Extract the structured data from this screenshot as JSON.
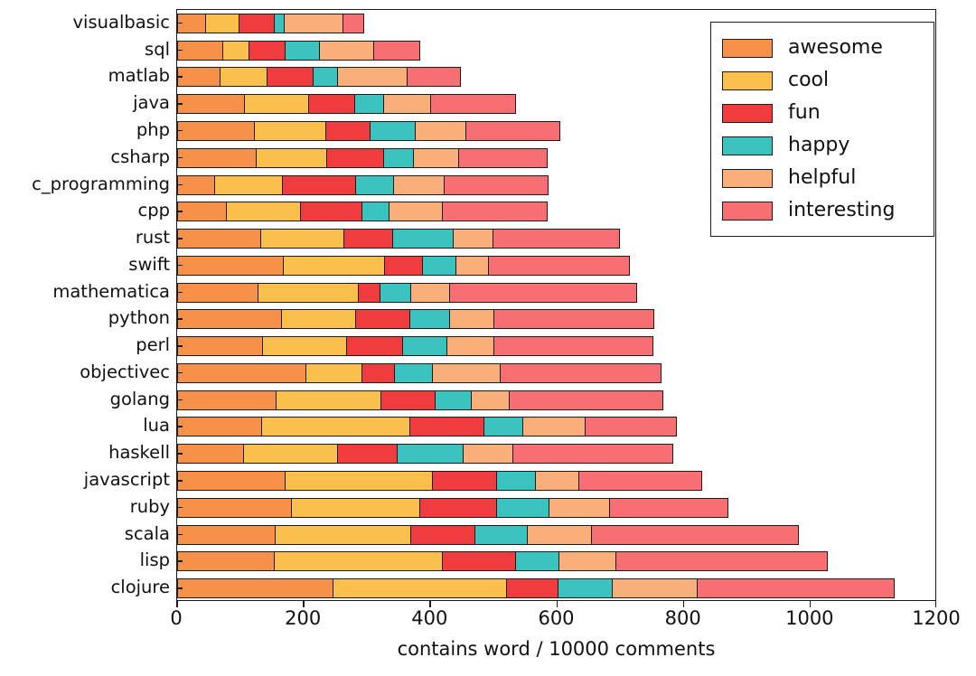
{
  "chart_data": {
    "type": "bar",
    "orientation": "horizontal",
    "stacked": true,
    "title": "",
    "xlabel": "contains word / 10000 comments",
    "ylabel": "",
    "xlim": [
      0,
      1200
    ],
    "xticks": [
      0,
      200,
      400,
      600,
      800,
      1000,
      1200
    ],
    "grid": false,
    "legend_position": "upper right",
    "legend_entries": [
      "awesome",
      "cool",
      "fun",
      "happy",
      "helpful",
      "interesting"
    ],
    "colors": {
      "awesome": "#F7914A",
      "cool": "#FBBF4C",
      "fun": "#F03C3F",
      "happy": "#3BC3C0",
      "helpful": "#FAAE79",
      "interesting": "#F76F72"
    },
    "series": [
      {
        "name": "awesome",
        "values": [
          47,
          74,
          70,
          108,
          124,
          126,
          61,
          79,
          133,
          169,
          129,
          167,
          137,
          205,
          158,
          135,
          107,
          172,
          182,
          157,
          155,
          248
        ]
      },
      {
        "name": "cool",
        "values": [
          54,
          43,
          76,
          103,
          114,
          114,
          109,
          119,
          134,
          162,
          161,
          118,
          135,
          91,
          168,
          236,
          150,
          235,
          205,
          215,
          267,
          276
        ]
      },
      {
        "name": "fun",
        "values": [
          59,
          59,
          75,
          76,
          73,
          92,
          118,
          100,
          80,
          63,
          37,
          89,
          90,
          54,
          87,
          120,
          96,
          103,
          124,
          105,
          118,
          84
        ]
      },
      {
        "name": "happy",
        "values": [
          18,
          57,
          40,
          47,
          74,
          50,
          62,
          45,
          97,
          55,
          50,
          64,
          73,
          61,
          60,
          63,
          107,
          64,
          85,
          85,
          71,
          87
        ]
      },
      {
        "name": "helpful",
        "values": [
          95,
          88,
          113,
          77,
          81,
          73,
          82,
          87,
          66,
          53,
          64,
          73,
          76,
          110,
          62,
          101,
          81,
          71,
          97,
          103,
          93,
          137
        ]
      },
      {
        "name": "interesting",
        "values": [
          34,
          74,
          86,
          135,
          151,
          142,
          166,
          167,
          200,
          224,
          296,
          254,
          253,
          255,
          244,
          145,
          254,
          195,
          189,
          328,
          335,
          312
        ]
      }
    ],
    "categories": [
      "visualbasic",
      "sql",
      "matlab",
      "java",
      "php",
      "csharp",
      "c_programming",
      "cpp",
      "rust",
      "swift",
      "mathematica",
      "python",
      "perl",
      "objectivec",
      "golang",
      "lua",
      "haskell",
      "javascript",
      "ruby",
      "scala",
      "lisp",
      "clojure"
    ],
    "totals": [
      307,
      395,
      460,
      546,
      617,
      597,
      598,
      597,
      710,
      726,
      737,
      765,
      764,
      776,
      779,
      800,
      795,
      840,
      882,
      993,
      1039,
      1144
    ]
  },
  "legend": {
    "items": [
      {
        "label": "awesome",
        "color": "#F7914A",
        "swatch_name": "legend-swatch-awesome"
      },
      {
        "label": "cool",
        "color": "#FBBF4C",
        "swatch_name": "legend-swatch-cool"
      },
      {
        "label": "fun",
        "color": "#F03C3F",
        "swatch_name": "legend-swatch-fun"
      },
      {
        "label": "happy",
        "color": "#3BC3C0",
        "swatch_name": "legend-swatch-happy"
      },
      {
        "label": "helpful",
        "color": "#FAAE79",
        "swatch_name": "legend-swatch-helpful"
      },
      {
        "label": "interesting",
        "color": "#F76F72",
        "swatch_name": "legend-swatch-interesting"
      }
    ]
  },
  "axes": {
    "x_label": "contains word / 10000 comments",
    "x_ticks": [
      "0",
      "200",
      "400",
      "600",
      "800",
      "1000",
      "1200"
    ]
  }
}
